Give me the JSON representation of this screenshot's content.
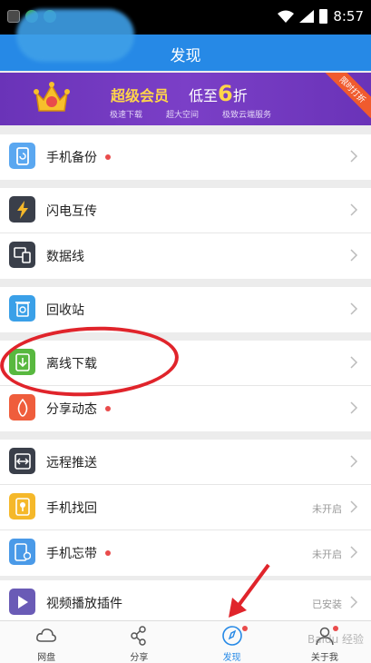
{
  "status_bar": {
    "time": "8:57"
  },
  "header": {
    "title": "发现"
  },
  "banner": {
    "vip_label": "超级会员",
    "discount_prefix": "低至",
    "discount_value": "6",
    "discount_suffix": "折",
    "features": [
      "极速下载",
      "超大空间",
      "极致云端服务"
    ],
    "ribbon": "限时打折"
  },
  "groups": [
    {
      "items": [
        {
          "id": "backup",
          "label": "手机备份",
          "dot": true,
          "icon": "phone-backup-icon",
          "color": "#5aa7f0"
        }
      ]
    },
    {
      "items": [
        {
          "id": "flash",
          "label": "闪电互传",
          "dot": false,
          "icon": "lightning-icon",
          "color": "#3a3f4a"
        },
        {
          "id": "cable",
          "label": "数据线",
          "dot": false,
          "icon": "data-cable-icon",
          "color": "#3a3f4a"
        }
      ]
    },
    {
      "items": [
        {
          "id": "recycle",
          "label": "回收站",
          "dot": false,
          "icon": "recycle-bin-icon",
          "color": "#3aa0e8"
        }
      ]
    },
    {
      "items": [
        {
          "id": "offline",
          "label": "离线下载",
          "dot": false,
          "icon": "offline-download-icon",
          "color": "#58b83f"
        },
        {
          "id": "share",
          "label": "分享动态",
          "dot": true,
          "icon": "share-feed-icon",
          "color": "#ef5d3c"
        }
      ]
    },
    {
      "items": [
        {
          "id": "remote",
          "label": "远程推送",
          "dot": false,
          "icon": "remote-push-icon",
          "color": "#3a3f4a"
        },
        {
          "id": "find",
          "label": "手机找回",
          "dot": false,
          "status": "未开启",
          "icon": "phone-find-icon",
          "color": "#f5b82a"
        },
        {
          "id": "forget",
          "label": "手机忘带",
          "dot": true,
          "status": "未开启",
          "icon": "phone-forget-icon",
          "color": "#4a9ae8"
        }
      ]
    },
    {
      "items": [
        {
          "id": "video",
          "label": "视频播放插件",
          "dot": false,
          "status": "已安装",
          "icon": "video-player-icon",
          "color": "#6a5bb6"
        }
      ]
    }
  ],
  "tabs": [
    {
      "id": "netdisk",
      "label": "网盘",
      "icon": "cloud-icon",
      "active": false,
      "dot": false
    },
    {
      "id": "share",
      "label": "分享",
      "icon": "share-icon",
      "active": false,
      "dot": false
    },
    {
      "id": "discover",
      "label": "发现",
      "icon": "compass-icon",
      "active": true,
      "dot": true
    },
    {
      "id": "me",
      "label": "关于我",
      "icon": "person-icon",
      "active": false,
      "dot": true
    }
  ],
  "watermark": "Baidu 经验",
  "colors": {
    "primary": "#2689e6",
    "red_dot": "#e94b4b",
    "annotation": "#e0242b"
  }
}
